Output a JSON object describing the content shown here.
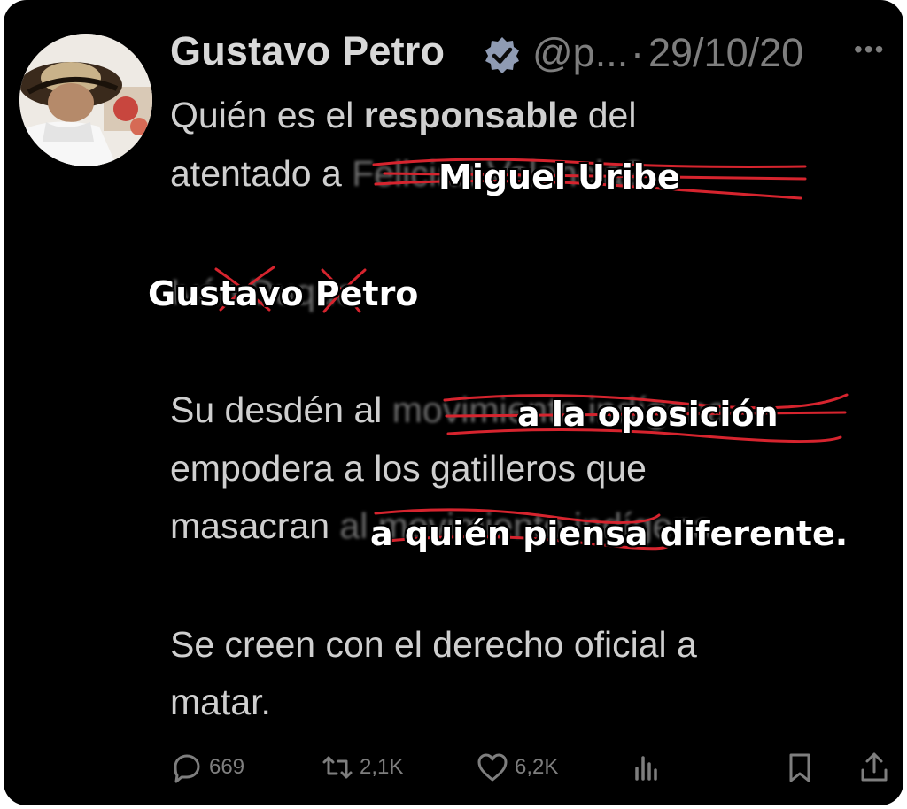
{
  "tweet": {
    "author_name": "Gustavo Petro",
    "handle": "@p...",
    "separator": "·",
    "date": "29/10/20",
    "more_icon": "more-dots-icon",
    "line1_pre": "Quién es el ",
    "line1_bold": "responsable",
    "line1_post": " del",
    "line2_visible": "atentado a ",
    "line2_struck": "Felician Valencia?",
    "line3_struck": "Iván Duque",
    "line4_visible": "Su desdén al ",
    "line4_struck": "movimiento indígena",
    "line5": "empodera a los gatilleros que",
    "line6_visible": "masacran ",
    "line6_struck": "al movimiento indígena",
    "line7": "Se creen con el derecho oficial a",
    "line8": "matar."
  },
  "overlays": {
    "target": "Miguel Uribe",
    "responsible": "Gustavo Petro",
    "group": "a la oposición",
    "victims": "a quién piensa diferente."
  },
  "actions": {
    "reply_count": "669",
    "retweet_count": "2,1K",
    "like_count": "6,2K",
    "icons": [
      "reply-icon",
      "retweet-icon",
      "like-icon",
      "views-icon",
      "bookmark-icon",
      "share-icon"
    ]
  },
  "colors": {
    "background": "#000000",
    "verified_badge": "#8f9bb3",
    "strike": "#d6242e",
    "overlay_text": "#ffffff"
  }
}
